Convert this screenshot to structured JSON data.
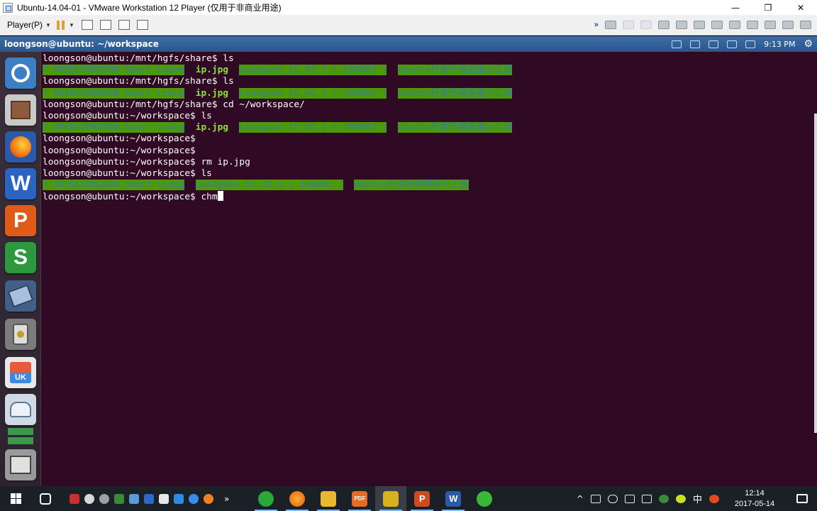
{
  "window": {
    "title": "Ubuntu-14.04-01 - VMware Workstation 12 Player (仅用于非商业用途)",
    "minimize": "—",
    "maximize": "❐",
    "close": "✕"
  },
  "vm_toolbar": {
    "player_menu": "Player(P)",
    "double_arrow": "»"
  },
  "ubuntu_panel": {
    "window_title": "loongson@ubuntu: ~/workspace",
    "time": "9:13 PM",
    "settings_glyph": "⚙"
  },
  "launcher": {
    "items": [
      "dash-home",
      "files",
      "firefox",
      "libreoffice-writer",
      "wps-presentation",
      "wps-spreadsheets",
      "video-player",
      "speaker",
      "ubuntu-kylin",
      "driver",
      "stack",
      "trash"
    ],
    "writer_letter": "W",
    "present_letter": "P",
    "sheet_letter": "S",
    "uk_letter": "UK"
  },
  "terminal": {
    "lines": [
      {
        "prompt": "loongson@ubuntu:/mnt/hgfs/share$ ",
        "cmd": "ls"
      },
      {
        "ls": [
          "? OPENLOONGSON Smart Loong",
          "ip.jpg",
          "Loongson_1C_V2.1 ( 160803 )",
          "ubuntu开发环境搭建小工具"
        ]
      },
      {
        "prompt": "loongson@ubuntu:/mnt/hgfs/share$ ",
        "cmd": "ls"
      },
      {
        "ls": [
          "? OPENLOONGSON Smart Loong",
          "ip.jpg",
          "Loongson_1C_V2.1 ( 160803 )",
          "ubuntu开发环境搭建小工具"
        ]
      },
      {
        "prompt": "loongson@ubuntu:/mnt/hgfs/share$ ",
        "cmd": "cd ~/workspace/"
      },
      {
        "prompt": "loongson@ubuntu:~/workspace$ ",
        "cmd": "ls"
      },
      {
        "ls": [
          "? OPENLOONGSON Smart Loong",
          "ip.jpg",
          "Loongson_1C_V2.1 ( 160803 )",
          "ubuntu开发环境搭建小工具"
        ]
      },
      {
        "prompt": "loongson@ubuntu:~/workspace$ ",
        "cmd": ""
      },
      {
        "prompt": "loongson@ubuntu:~/workspace$ ",
        "cmd": ""
      },
      {
        "prompt": "loongson@ubuntu:~/workspace$ ",
        "cmd": "rm ip.jpg"
      },
      {
        "prompt": "loongson@ubuntu:~/workspace$ ",
        "cmd": "ls"
      },
      {
        "ls": [
          "? OPENLOONGSON Smart Loong",
          "Loongson_1C_V2.1 ( 160803 )",
          "ubuntu开发环境搭建小工具"
        ]
      },
      {
        "prompt": "loongson@ubuntu:~/workspace$ ",
        "cmd": "chm",
        "cursor": true
      }
    ],
    "colors": {
      "background": "#300a24",
      "highlight": "#4e9a06",
      "exec": "#8ae234"
    }
  },
  "taskbar": {
    "clock_time": "12:14",
    "clock_date": "2017-05-14",
    "tray_chevron": "^",
    "ime_label": "中",
    "more_glyph": "»",
    "pinned": [
      "wechat",
      "firefox",
      "file-explorer",
      "pdf-reader",
      "vmware-player",
      "powerpoint",
      "word",
      "360-browser"
    ],
    "pdf_label": "PDF",
    "ppt_label": "P",
    "word_label": "W"
  }
}
